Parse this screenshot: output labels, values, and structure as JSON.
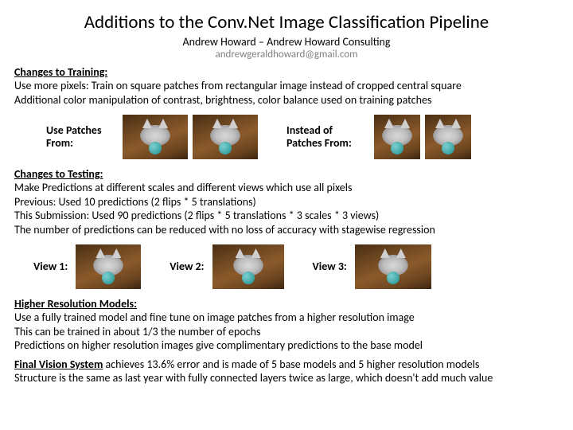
{
  "title": "Additions to the Conv.Net Image Classification Pipeline",
  "subtitle": "Andrew Howard – Andrew Howard Consulting",
  "email": "andrewgeraldhoward@gmail.com",
  "training": {
    "heading": "Changes to Training:",
    "line1": "Use more pixels: Train on square patches from rectangular image instead of cropped central square",
    "line2": "Additional color manipulation of contrast, brightness, color balance used on training patches",
    "caption_from": "Use Patches From:",
    "caption_instead": "Instead of Patches From:"
  },
  "testing": {
    "heading": "Changes to Testing:",
    "line1": "Make Predictions at different scales and different views which use all pixels",
    "line2": "Previous: Used 10 predictions (2 flips * 5 translations)",
    "line3": "This Submission: Used 90 predictions (2 flips * 5 translations * 3 scales * 3 views)",
    "line4": "The number of predictions can be reduced with no loss of accuracy with stagewise regression",
    "view1": "View 1:",
    "view2": "View 2:",
    "view3": "View 3:"
  },
  "hires": {
    "heading": "Higher Resolution Models:",
    "line1": "Use a fully trained model and fine tune on image patches from a higher resolution image",
    "line2": "This can be trained in about 1/3 the number of epochs",
    "line3": "Predictions on higher resolution images give complimentary predictions to the base model"
  },
  "final": {
    "lead": "Final Vision System",
    "rest1": " achieves 13.6% error and is made of 5 base models and 5 higher resolution models",
    "line2": "Structure is the same as last year with fully connected layers twice as large, which doesn't add much value"
  }
}
